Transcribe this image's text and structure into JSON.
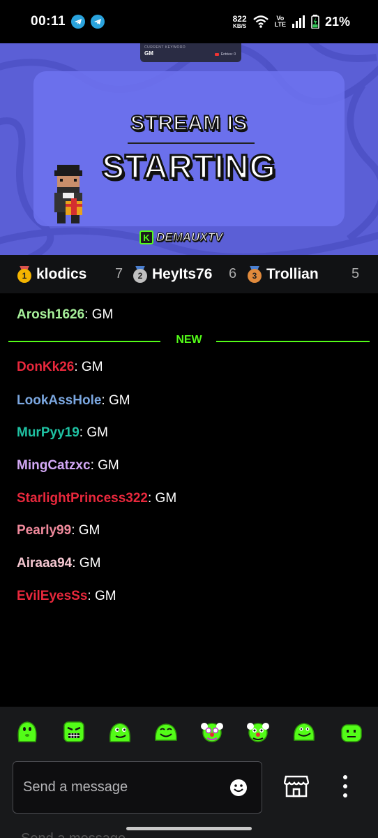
{
  "status_bar": {
    "time": "00:11",
    "net_speed_value": "822",
    "net_speed_unit": "KB/S",
    "volte_top": "Vo",
    "volte_bottom": "LTE",
    "battery": "21%"
  },
  "stream": {
    "keyword_label": "CURRENT KEYWORD",
    "keyword_value": "GM",
    "entries": "Entries: 0",
    "title_line1": "STREAM IS",
    "title_line2": "STARTING",
    "brand": "DEMAUXTV",
    "brand_k": "K",
    "colors": {
      "background": "#5b5fd6",
      "panel": "#6e73f0",
      "brand": "#53fc18"
    }
  },
  "leaderboard": [
    {
      "rank": "1",
      "name": "klodics",
      "count": "7",
      "medal_color": "#f4b400"
    },
    {
      "rank": "2",
      "name": "HeyIts76",
      "count": "6",
      "medal_color": "#c0c0c0"
    },
    {
      "rank": "3",
      "name": "Trollian",
      "count": "5",
      "medal_color": "#e08a3c"
    }
  ],
  "chat": {
    "separator_label": "NEW",
    "messages": [
      {
        "user": "Arosh1626",
        "text": ": GM",
        "color": "#a6f09a"
      },
      {
        "user": "DonKk26",
        "text": ": GM",
        "color": "#e8283c"
      },
      {
        "user": "LookAssHole",
        "text": ": GM",
        "color": "#7ba7e0"
      },
      {
        "user": "MurPyy19",
        "text": ": GM",
        "color": "#1fc2a3"
      },
      {
        "user": "MingCatzxc",
        "text": ": GM",
        "color": "#d3a8f5"
      },
      {
        "user": "StarlightPrincess322",
        "text": ": GM",
        "color": "#e8283c"
      },
      {
        "user": "Pearly99",
        "text": ": GM",
        "color": "#f08a9c"
      },
      {
        "user": "Airaaa94",
        "text": ": GM",
        "color": "#f4c6d0"
      },
      {
        "user": "EvilEyesSs",
        "text": ": GM",
        "color": "#e8283c"
      }
    ]
  },
  "emotes": [
    "kick-emote-blob",
    "kick-emote-angry",
    "kick-emote-smirk",
    "kick-emote-grin",
    "kick-emote-clown",
    "kick-emote-clown-2",
    "kick-emote-smile",
    "kick-emote-bored"
  ],
  "composer": {
    "placeholder": "Send a message",
    "ghost_text": "Send a message",
    "emoji_icon": "smiley-icon",
    "store_icon": "store-icon",
    "menu_icon": "kebab-menu-icon"
  }
}
